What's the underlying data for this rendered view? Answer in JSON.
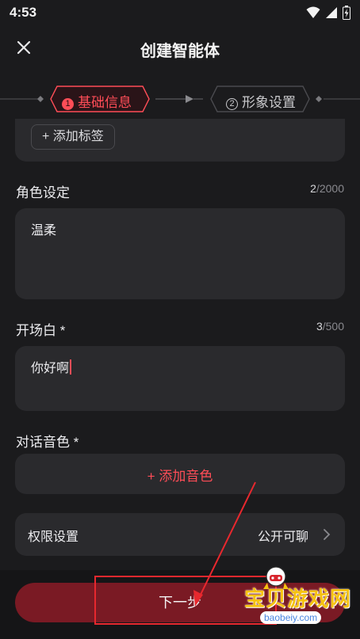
{
  "status": {
    "time": "4:53"
  },
  "header": {
    "title": "创建智能体"
  },
  "stepper": {
    "steps": [
      {
        "num": "1",
        "label": "基础信息",
        "active": true
      },
      {
        "num": "2",
        "label": "形象设置",
        "active": false
      }
    ]
  },
  "tags": {
    "add_label": "+ 添加标签"
  },
  "role": {
    "label": "角色设定",
    "count": "2",
    "max": "/2000",
    "value": "温柔"
  },
  "opening": {
    "label": "开场白 *",
    "count": "3",
    "max": "/500",
    "value": "你好啊"
  },
  "voice": {
    "label": "对话音色 *",
    "add_label": "+ 添加音色"
  },
  "permission": {
    "label": "权限设置",
    "value": "公开可聊"
  },
  "footer": {
    "next_label": "下一步"
  },
  "watermark": {
    "title": "宝贝游戏网",
    "url": "baobeiy.com"
  },
  "colors": {
    "accent": "#ff4d57",
    "button_bg": "#7a1a24",
    "card_bg": "#2a2a2d",
    "page_bg": "#1b1b1d",
    "annotation": "#e8282e"
  }
}
